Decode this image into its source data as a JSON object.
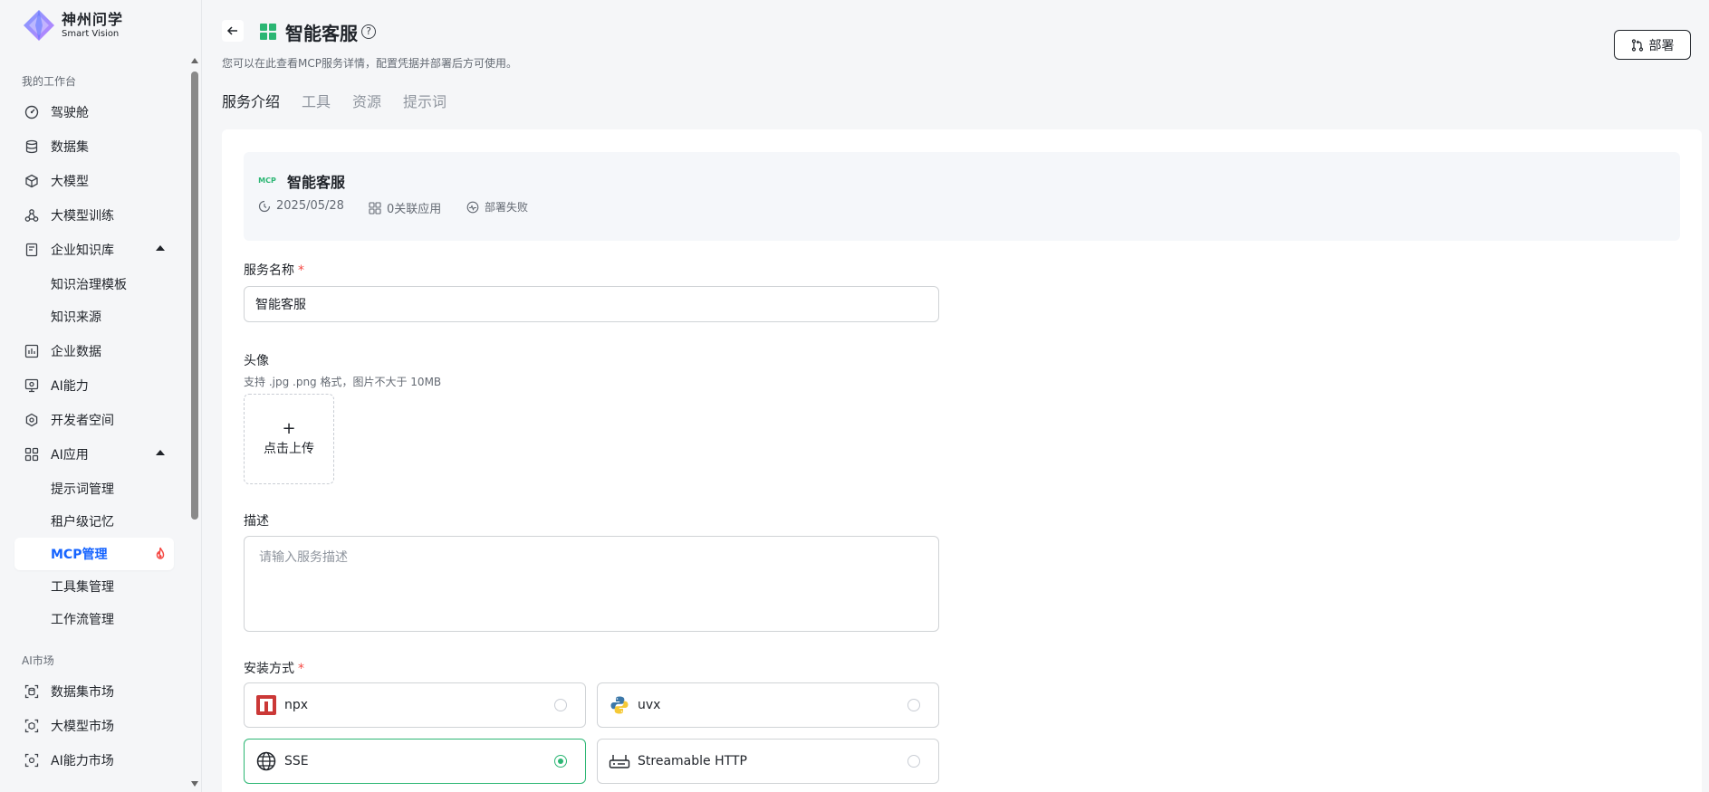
{
  "brand": {
    "name_cn": "神州问学",
    "name_en": "Smart Vision"
  },
  "sidebar": {
    "section1": "我的工作台",
    "items": [
      {
        "label": "驾驶舱",
        "icon": "dashboard-icon"
      },
      {
        "label": "数据集",
        "icon": "database-icon"
      },
      {
        "label": "大模型",
        "icon": "cube-icon"
      },
      {
        "label": "大模型训练",
        "icon": "training-icon"
      },
      {
        "label": "企业知识库",
        "icon": "book-icon",
        "expanded": true
      },
      {
        "label": "知识治理模板"
      },
      {
        "label": "知识来源"
      },
      {
        "label": "企业数据",
        "icon": "chart-icon"
      },
      {
        "label": "AI能力",
        "icon": "ai-ability-icon"
      },
      {
        "label": "开发者空间",
        "icon": "developer-icon"
      },
      {
        "label": "AI应用",
        "icon": "apps-grid-icon",
        "expanded": true
      },
      {
        "label": "提示词管理"
      },
      {
        "label": "租户级记忆"
      },
      {
        "label": "MCP管理",
        "active": true,
        "badge_icon": "fire-icon"
      },
      {
        "label": "工具集管理"
      },
      {
        "label": "工作流管理"
      }
    ],
    "section2": "AI市场",
    "market_items": [
      {
        "label": "数据集市场",
        "icon": "scan-database-icon"
      },
      {
        "label": "大模型市场",
        "icon": "scan-cube-icon"
      },
      {
        "label": "AI能力市场",
        "icon": "scan-ai-icon"
      }
    ]
  },
  "header": {
    "title": "智能客服",
    "description": "您可以在此查看MCP服务详情，配置凭据并部署后方可使用。",
    "deploy_label": "部署"
  },
  "tabs": [
    "服务介绍",
    "工具",
    "资源",
    "提示词"
  ],
  "active_tab": 0,
  "info": {
    "badge": "MCP",
    "name": "智能客服",
    "date": "2025/05/28",
    "linked_apps": "0关联应用",
    "status": "部署失败"
  },
  "form": {
    "service_name_label": "服务名称",
    "service_name_value": "智能客服",
    "avatar_label": "头像",
    "avatar_hint": "支持 .jpg .png 格式，图片不大于 10MB",
    "upload_plus": "+",
    "upload_label": "点击上传",
    "desc_label": "描述",
    "desc_placeholder": "请输入服务描述",
    "install_label": "安装方式",
    "required_mark": "*",
    "install_options": [
      {
        "label": "npx",
        "icon": "npm-icon",
        "selected": false
      },
      {
        "label": "uvx",
        "icon": "python-icon",
        "selected": false
      },
      {
        "label": "SSE",
        "icon": "globe-icon",
        "selected": true
      },
      {
        "label": "Streamable HTTP",
        "icon": "router-icon",
        "selected": false
      }
    ]
  },
  "colors": {
    "accent": "#2bb673",
    "primary_blue": "#1664ff",
    "danger": "#f54a45"
  }
}
